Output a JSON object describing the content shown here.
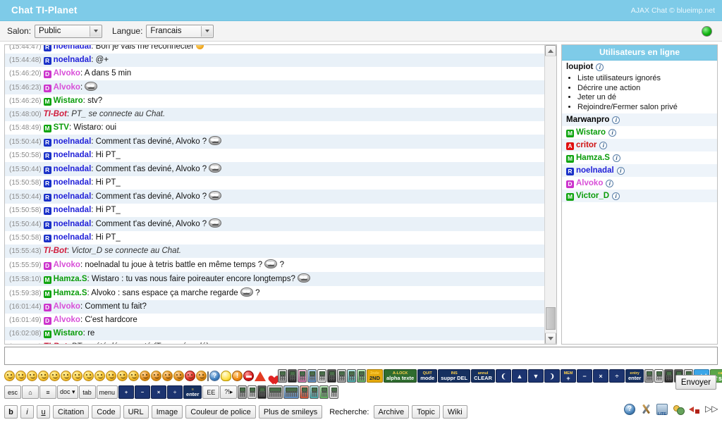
{
  "header": {
    "title": "Chat TI-Planet",
    "credit": "AJAX Chat © blueimp.net",
    "status_icon": "online-status-dot",
    "status_color": "#12b312",
    "accent_color": "#7ecbe8"
  },
  "channelbar": {
    "room_label": "Salon:",
    "room_value": "Public",
    "language_label": "Langue:",
    "language_value": "Francais"
  },
  "messages": [
    {
      "time": "(15:44:47)",
      "badge": "R",
      "user": "noelnadal",
      "color": "blue",
      "text": "Bon je vais me reconnecter",
      "emoji": "smile-orange",
      "cut": "top"
    },
    {
      "time": "(15:44:48)",
      "badge": "R",
      "user": "noelnadal",
      "color": "blue",
      "text": "@+"
    },
    {
      "time": "(15:46:20)",
      "badge": "D",
      "user": "Alvoko",
      "color": "pink",
      "text": "A dans 5 min"
    },
    {
      "time": "(15:46:23)",
      "badge": "D",
      "user": "Alvoko",
      "color": "pink",
      "text": "",
      "emoji": "troll-face"
    },
    {
      "time": "(15:46:26)",
      "badge": "M",
      "user": "Wistaro",
      "color": "green",
      "text": "stv?"
    },
    {
      "time": "(15:48:00)",
      "badge": "",
      "user": "TI-Bot",
      "color": "bot",
      "text": "PT_ se connecte au Chat.",
      "italic": true
    },
    {
      "time": "(15:48:49)",
      "badge": "M",
      "user": "STV",
      "color": "green",
      "text": "Wistaro: oui"
    },
    {
      "time": "(15:50:44)",
      "badge": "R",
      "user": "noelnadal",
      "color": "blue",
      "text": "Comment t'as deviné, Alvoko ?",
      "emoji": "troll-face"
    },
    {
      "time": "(15:50:58)",
      "badge": "R",
      "user": "noelnadal",
      "color": "blue",
      "text": "Hi PT_"
    },
    {
      "time": "(15:50:44)",
      "badge": "R",
      "user": "noelnadal",
      "color": "blue",
      "text": "Comment t'as deviné, Alvoko ?",
      "emoji": "troll-face"
    },
    {
      "time": "(15:50:58)",
      "badge": "R",
      "user": "noelnadal",
      "color": "blue",
      "text": "Hi PT_"
    },
    {
      "time": "(15:50:44)",
      "badge": "R",
      "user": "noelnadal",
      "color": "blue",
      "text": "Comment t'as deviné, Alvoko ?",
      "emoji": "troll-face"
    },
    {
      "time": "(15:50:58)",
      "badge": "R",
      "user": "noelnadal",
      "color": "blue",
      "text": "Hi PT_"
    },
    {
      "time": "(15:50:44)",
      "badge": "R",
      "user": "noelnadal",
      "color": "blue",
      "text": "Comment t'as deviné, Alvoko ?",
      "emoji": "troll-face"
    },
    {
      "time": "(15:50:58)",
      "badge": "R",
      "user": "noelnadal",
      "color": "blue",
      "text": "Hi PT_"
    },
    {
      "time": "(15:55:43)",
      "badge": "",
      "user": "TI-Bot",
      "color": "bot",
      "text": "Victor_D se connecte au Chat.",
      "italic": true
    },
    {
      "time": "(15:55:59)",
      "badge": "D",
      "user": "Alvoko",
      "color": "pink",
      "text": "noelnadal tu joue à tetris battle en même temps ?",
      "emoji": "troll-face",
      "suffix": "?"
    },
    {
      "time": "(15:58:10)",
      "badge": "M",
      "user": "Hamza.S",
      "color": "green",
      "text": "Wistaro : tu vas nous faire poireauter encore longtemps?",
      "emoji": "troll-face"
    },
    {
      "time": "(15:59:38)",
      "badge": "M",
      "user": "Hamza.S",
      "color": "green",
      "text": "Alvoko : sans espace ça marche regarde",
      "emoji": "troll-face",
      "suffix": "?"
    },
    {
      "time": "(16:01:44)",
      "badge": "D",
      "user": "Alvoko",
      "color": "pink",
      "text": "Comment tu fait?"
    },
    {
      "time": "(16:01:49)",
      "badge": "D",
      "user": "Alvoko",
      "color": "pink",
      "text": "C'est hardcore"
    },
    {
      "time": "(16:02:08)",
      "badge": "M",
      "user": "Wistaro",
      "color": "green",
      "text": "re"
    },
    {
      "time": "(16:04:19)",
      "badge": "",
      "user": "TI-Bot",
      "color": "bot",
      "text": "PT_ a été déconnecté (Temps écoulé)",
      "italic": true,
      "cut": "bottom"
    }
  ],
  "users_panel": {
    "title": "Utilisateurs en ligne",
    "self": {
      "name": "loupiot",
      "info": "i"
    },
    "commands": [
      "Liste utilisateurs ignorés",
      "Décrire une action",
      "Jeter un dé",
      "Rejoindre/Fermer salon privé"
    ],
    "users": [
      {
        "name": "Marwanpro",
        "badge": "",
        "color": "plain"
      },
      {
        "name": "Wistaro",
        "badge": "M",
        "color": "green"
      },
      {
        "name": "critor",
        "badge": "A",
        "color": "red"
      },
      {
        "name": "Hamza.S",
        "badge": "M",
        "color": "green"
      },
      {
        "name": "noelnadal",
        "badge": "R",
        "color": "blue"
      },
      {
        "name": "Alvoko",
        "badge": "D",
        "color": "pink"
      },
      {
        "name": "Victor_D",
        "badge": "M",
        "color": "green"
      }
    ]
  },
  "input": {
    "value": "",
    "placeholder": "",
    "send_label": "Envoyer"
  },
  "smiley_row": [
    {
      "name": "smiley-happy",
      "kind": "emo"
    },
    {
      "name": "smiley-sad",
      "kind": "emo"
    },
    {
      "name": "smiley-neutral",
      "kind": "emo"
    },
    {
      "name": "smiley-wink",
      "kind": "emo"
    },
    {
      "name": "smiley-grin",
      "kind": "emo"
    },
    {
      "name": "smiley-shock",
      "kind": "emo"
    },
    {
      "name": "smiley-confused",
      "kind": "emo"
    },
    {
      "name": "smiley-tongue",
      "kind": "emo"
    },
    {
      "name": "smiley-roll-eyes",
      "kind": "emo"
    },
    {
      "name": "smiley-cool",
      "kind": "emo cool"
    },
    {
      "name": "smiley-sunglasses",
      "kind": "emo cool"
    },
    {
      "name": "smiley-sleep",
      "kind": "emo cool"
    },
    {
      "name": "smiley-devil",
      "kind": "emo dark"
    },
    {
      "name": "smiley-angry",
      "kind": "emo dark"
    },
    {
      "name": "smiley-sick",
      "kind": "emo dark"
    },
    {
      "name": "smiley-money",
      "kind": "emo dark"
    },
    {
      "name": "smiley-shout",
      "kind": "emo red"
    },
    {
      "name": "smiley-bomb",
      "kind": "emo dark"
    },
    {
      "name": "troll-face-icon",
      "kind": "troll"
    },
    {
      "name": "question-icon",
      "kind": "info"
    },
    {
      "name": "idea-bulb-icon",
      "kind": "bulb"
    },
    {
      "name": "exclamation-icon",
      "kind": "warn-o"
    },
    {
      "name": "forbidden-icon",
      "kind": "stop"
    },
    {
      "name": "warning-triangle-icon",
      "kind": "tri"
    },
    {
      "name": "heart-icon",
      "kind": "heart"
    }
  ],
  "calculator_row1": [
    {
      "name": "calc-ti-grey",
      "color": ""
    },
    {
      "name": "calc-ti-black",
      "color": "c-black"
    },
    {
      "name": "calc-ti-pink",
      "color": "c-pink"
    },
    {
      "name": "calc-ti-blue",
      "color": "c-blue"
    },
    {
      "name": "calc-ti-white",
      "color": "c-white"
    },
    {
      "name": "calc-ti-dark",
      "color": "c-black"
    },
    {
      "name": "calc-ti-grey2",
      "color": ""
    },
    {
      "name": "calc-ti-teal",
      "color": "c-teal"
    },
    {
      "name": "calc-ti-green",
      "color": "c-green"
    }
  ],
  "keys_row1": [
    {
      "name": "key-2nd",
      "sup": "2nde",
      "main": "2ND",
      "cls": "y2"
    },
    {
      "name": "key-alpha",
      "sup": "A-LOCK",
      "main": "alpha texte",
      "cls": "grn"
    },
    {
      "name": "key-mode",
      "sup": "QUIT",
      "main": "mode",
      "cls": "dark"
    },
    {
      "name": "key-del",
      "sup": "INS",
      "main": "suppr DEL",
      "cls": "dark"
    },
    {
      "name": "key-clear",
      "sup": "annul",
      "main": "CLEAR",
      "cls": "dark"
    },
    {
      "name": "key-arrow-left",
      "sup": "",
      "main": "❨",
      "cls": "big"
    },
    {
      "name": "key-arrow-up",
      "sup": "",
      "main": "▲",
      "cls": "big"
    },
    {
      "name": "key-arrow-down",
      "sup": "",
      "main": "▼",
      "cls": "big"
    },
    {
      "name": "key-arrow-right",
      "sup": "",
      "main": "❩",
      "cls": "big"
    },
    {
      "name": "key-plus",
      "sup": "MEM",
      "main": "+",
      "cls": "big"
    },
    {
      "name": "key-minus",
      "sup": "",
      "main": "−",
      "cls": "big"
    },
    {
      "name": "key-multiply",
      "sup": "",
      "main": "×",
      "cls": "big"
    },
    {
      "name": "key-divide",
      "sup": "",
      "main": "÷",
      "cls": "big"
    },
    {
      "name": "key-entry",
      "sup": "entry",
      "main": "enter",
      "cls": "dark"
    }
  ],
  "calculator_row1b": [
    {
      "name": "calc-nspire-grey",
      "color": ""
    },
    {
      "name": "calc-nspire-white",
      "color": "c-white"
    },
    {
      "name": "calc-nspire-black",
      "color": "c-black"
    },
    {
      "name": "calc-nspire-dark",
      "color": "c-black"
    },
    {
      "name": "calc-nspire-grey2",
      "color": ""
    }
  ],
  "keys_row1_end": [
    {
      "name": "key-ctrl",
      "main": "ctrl",
      "cls": "ctrl"
    },
    {
      "name": "key-shift",
      "sup": "caps",
      "main": "⇧shift",
      "cls": "shift"
    }
  ],
  "keys_row2": [
    {
      "name": "key-esc",
      "main": "esc",
      "cls": "plain"
    },
    {
      "name": "key-home",
      "main": "⌂",
      "cls": "plain"
    },
    {
      "name": "key-scratchpad",
      "main": "≡",
      "cls": "plain"
    },
    {
      "name": "key-doc",
      "main": "doc ▾",
      "cls": "plain"
    },
    {
      "name": "key-tab",
      "main": "tab",
      "cls": "plain"
    },
    {
      "name": "key-menu",
      "main": "menu",
      "cls": "plain"
    },
    {
      "name": "key-nav-plus",
      "main": "+",
      "cls": ""
    },
    {
      "name": "key-nav-minus",
      "main": "−",
      "cls": ""
    },
    {
      "name": "key-nav-multiply",
      "main": "×",
      "cls": ""
    },
    {
      "name": "key-nav-divide",
      "main": "÷",
      "cls": ""
    },
    {
      "name": "key-nav-enter",
      "sup": "≡",
      "main": "enter",
      "cls": "dark"
    },
    {
      "name": "key-ee",
      "main": "EE",
      "cls": "plain"
    },
    {
      "name": "key-catalog",
      "main": "?!▸",
      "cls": "plain"
    }
  ],
  "calculator_row2": [
    {
      "name": "calc-casio-grey",
      "color": ""
    },
    {
      "name": "calc-casio-white",
      "color": "c-white"
    },
    {
      "name": "calc-casio-black",
      "color": "c-black"
    },
    {
      "name": "calc-hp-wide",
      "color": "c-wide"
    },
    {
      "name": "calc-hp-blue",
      "color": "c-blue c-wide"
    },
    {
      "name": "calc-nspire-orange",
      "color": "c-red"
    },
    {
      "name": "calc-nspire-teal",
      "color": "c-teal"
    },
    {
      "name": "calc-nspire-green",
      "color": "c-green"
    },
    {
      "name": "calc-nspire-light",
      "color": "c-white"
    }
  ],
  "format_toolbar": {
    "bold": "b",
    "italic": "i",
    "underline": "u",
    "quote": "Citation",
    "code": "Code",
    "url": "URL",
    "image": "Image",
    "font_color": "Couleur de police",
    "more_smileys": "Plus de smileys",
    "search_label": "Recherche:",
    "archive": "Archive",
    "topic": "Topic",
    "wiki": "Wiki"
  },
  "bottom_icons": [
    {
      "name": "help-icon",
      "glyph": "?"
    },
    {
      "name": "settings-tools-icon",
      "glyph": ""
    },
    {
      "name": "lite-version-icon",
      "glyph": ""
    },
    {
      "name": "users-icon",
      "glyph": ""
    },
    {
      "name": "sound-muted-icon",
      "glyph": ""
    },
    {
      "name": "fast-forward-icon",
      "glyph": "▷▷"
    }
  ]
}
